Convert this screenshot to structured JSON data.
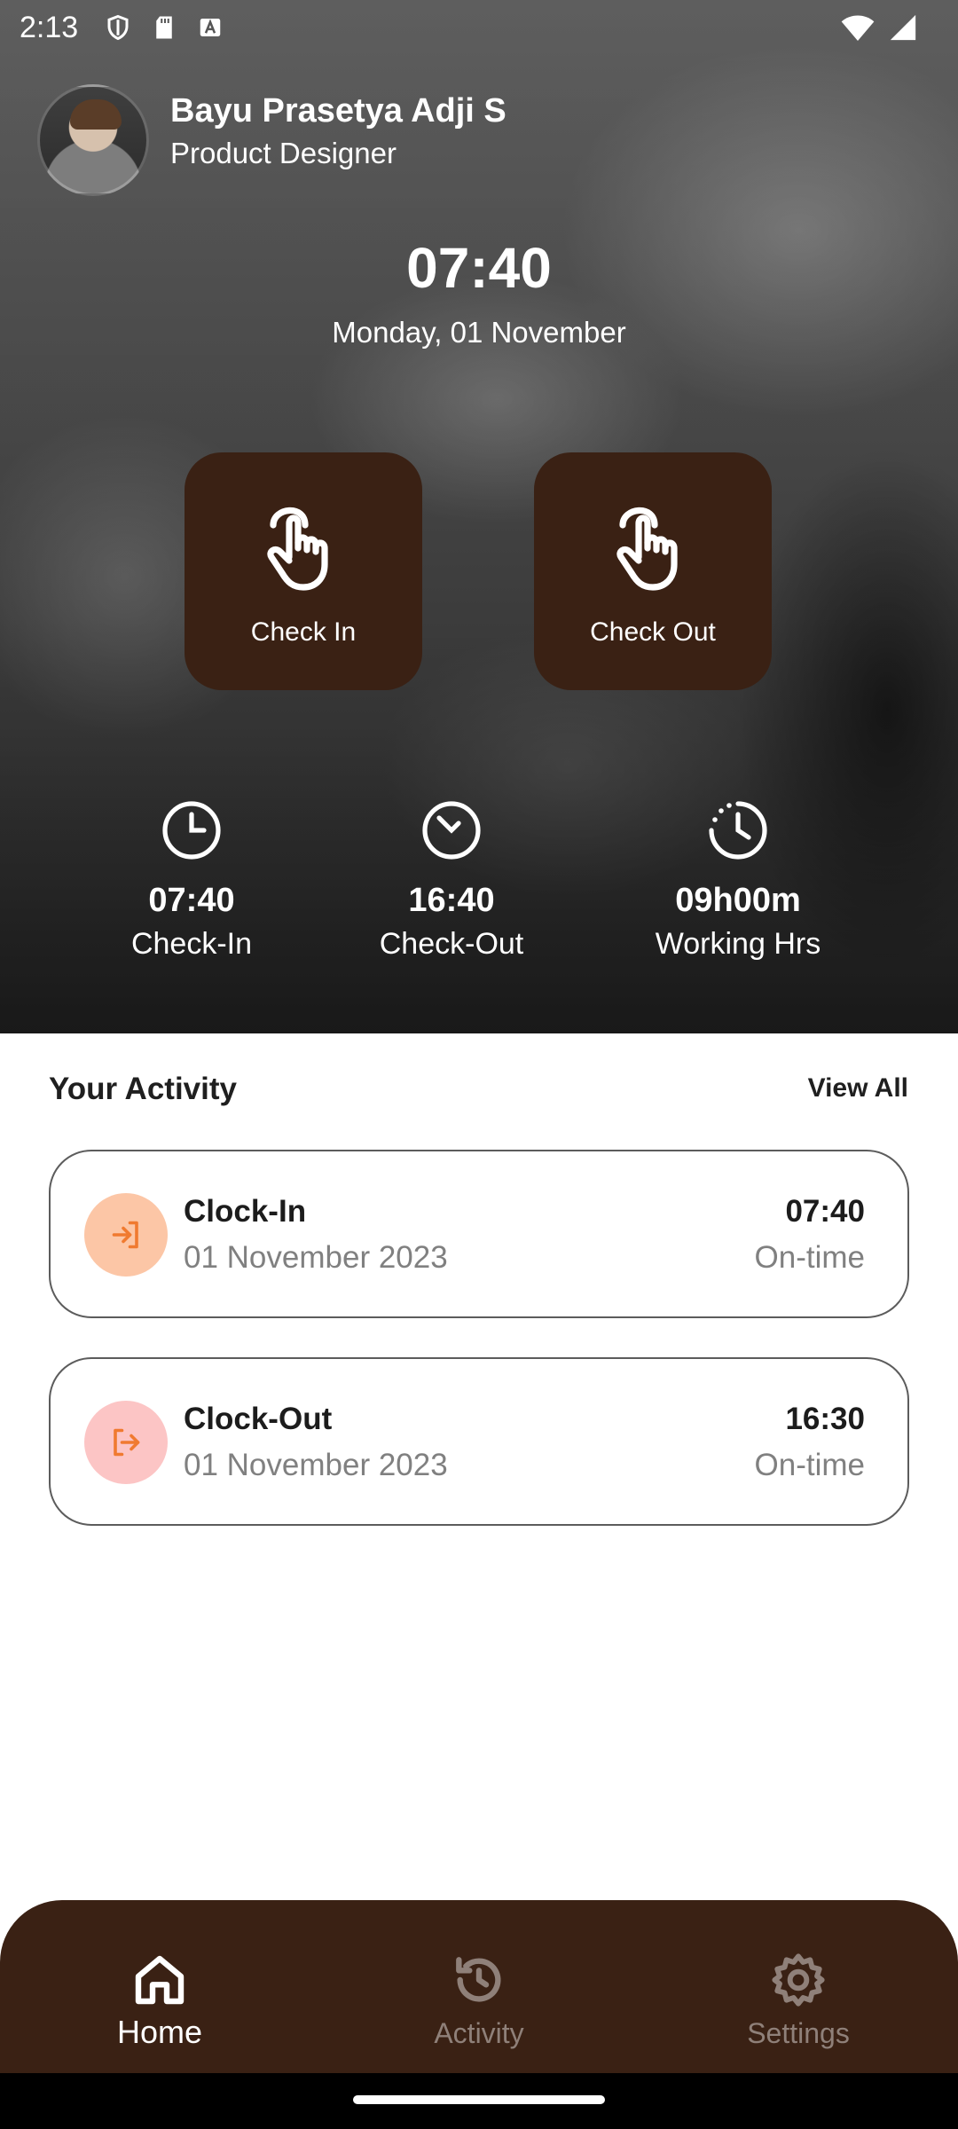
{
  "status_bar": {
    "time": "2:13"
  },
  "profile": {
    "name": "Bayu Prasetya Adji S",
    "role": "Product Designer"
  },
  "clock": {
    "time": "07:40",
    "date": "Monday, 01 November"
  },
  "actions": {
    "check_in_label": "Check In",
    "check_out_label": "Check Out"
  },
  "stats": [
    {
      "value": "07:40",
      "caption": "Check-In",
      "icon": "clock-icon"
    },
    {
      "value": "16:40",
      "caption": "Check-Out",
      "icon": "clock-icon"
    },
    {
      "value": "09h00m",
      "caption": "Working Hrs",
      "icon": "timer-icon"
    }
  ],
  "activity": {
    "title": "Your Activity",
    "view_all": "View All",
    "items": [
      {
        "title": "Clock-In",
        "date": "01 November 2023",
        "time": "07:40",
        "status": "On-time",
        "icon": "login-icon",
        "icon_bg": "#fcc6a6",
        "icon_color": "#f07a30"
      },
      {
        "title": "Clock-Out",
        "date": "01 November 2023",
        "time": "16:30",
        "status": "On-time",
        "icon": "logout-icon",
        "icon_bg": "#fcc5c5",
        "icon_color": "#f07a30"
      }
    ]
  },
  "nav": {
    "home": "Home",
    "activity": "Activity",
    "settings": "Settings"
  },
  "colors": {
    "primary_brown": "#3a2114",
    "inactive_nav": "#8f8079"
  }
}
